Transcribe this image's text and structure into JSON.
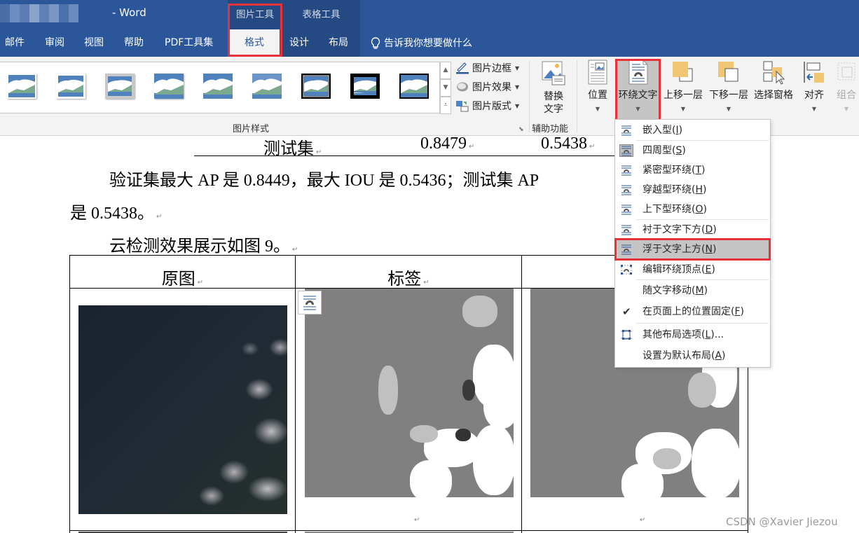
{
  "window": {
    "title_suffix": "- Word"
  },
  "context_groups": [
    {
      "label": "图片工具"
    },
    {
      "label": "表格工具"
    }
  ],
  "tabs": [
    {
      "label": "邮件"
    },
    {
      "label": "审阅"
    },
    {
      "label": "视图"
    },
    {
      "label": "帮助"
    },
    {
      "label": "PDF工具集"
    },
    {
      "label": "格式",
      "active": true
    },
    {
      "label": "设计"
    },
    {
      "label": "布局"
    }
  ],
  "tell_me": {
    "label": "告诉我你想要做什么"
  },
  "ribbon": {
    "picture_styles": {
      "group_label": "图片样式",
      "count": 9
    },
    "picture_border": "图片边框",
    "picture_effects": "图片效果",
    "picture_layout": "图片版式",
    "alt_text": {
      "line1": "替换",
      "line2": "文字"
    },
    "accessibility_group": "辅助功能",
    "position": "位置",
    "wrap_text": "环绕文字",
    "bring_forward": "上移一层",
    "send_backward": "下移一层",
    "selection_pane": "选择窗格",
    "align": "对齐",
    "group": "组合"
  },
  "wrap_menu": {
    "items": [
      {
        "label": "嵌入型(",
        "key": "I",
        "suffix": ")"
      },
      {
        "label": "四周型(",
        "key": "S",
        "suffix": ")"
      },
      {
        "label": "紧密型环绕(",
        "key": "T",
        "suffix": ")"
      },
      {
        "label": "穿越型环绕(",
        "key": "H",
        "suffix": ")"
      },
      {
        "label": "上下型环绕(",
        "key": "O",
        "suffix": ")"
      },
      {
        "label": "衬于文字下方(",
        "key": "D",
        "suffix": ")"
      },
      {
        "label": "浮于文字上方(",
        "key": "N",
        "suffix": ")",
        "highlighted": true
      },
      {
        "label": "编辑环绕顶点(",
        "key": "E",
        "suffix": ")"
      },
      {
        "label": "随文字移动(",
        "key": "M",
        "suffix": ")"
      },
      {
        "label": "在页面上的位置固定(",
        "key": "F",
        "suffix": ")",
        "checked": true
      },
      {
        "label": "其他布局选项(",
        "key": "L",
        "suffix": ")..."
      },
      {
        "label": "设置为默认布局(",
        "key": "A",
        "suffix": ")"
      }
    ]
  },
  "document": {
    "table_row": {
      "name": "测试集",
      "ap": "0.8479",
      "iou": "0.5438"
    },
    "para1_line1": "验证集最大 AP 是 0.8449，最大 IOU 是 0.5436；测试集 AP",
    "para1_line2": "是 0.5438。",
    "para2": "云检测效果展示如图 9。",
    "fig_table": {
      "col1": "原图",
      "col2": "标签"
    },
    "paragraph_mark": "↵"
  },
  "watermark": "CSDN @Xavier Jiezou",
  "colors": {
    "accent": "#2b579a",
    "highlight_box": "#e8323a",
    "selected_gray": "#c5c5c5"
  }
}
